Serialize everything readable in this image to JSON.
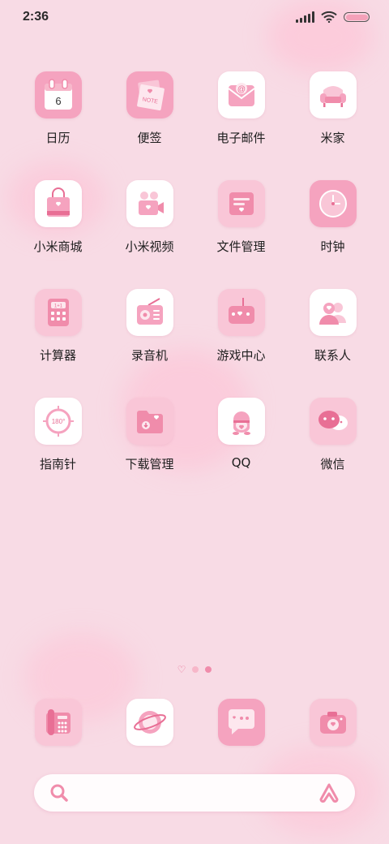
{
  "status_bar": {
    "time": "2:36"
  },
  "apps": [
    {
      "label": "日历",
      "calendar_day": "6"
    },
    {
      "label": "便签",
      "note_text": "NOTE"
    },
    {
      "label": "电子邮件"
    },
    {
      "label": "米家"
    },
    {
      "label": "小米商城"
    },
    {
      "label": "小米视频"
    },
    {
      "label": "文件管理"
    },
    {
      "label": "时钟"
    },
    {
      "label": "计算器",
      "calc_display": "1+1"
    },
    {
      "label": "录音机"
    },
    {
      "label": "游戏中心"
    },
    {
      "label": "联系人"
    },
    {
      "label": "指南针",
      "compass_reading": "180°"
    },
    {
      "label": "下载管理"
    },
    {
      "label": "QQ"
    },
    {
      "label": "微信"
    }
  ],
  "dock": [
    {
      "icon": "phone-icon"
    },
    {
      "icon": "browser-icon"
    },
    {
      "icon": "messages-icon"
    },
    {
      "icon": "camera-icon"
    }
  ],
  "page_indicator": {
    "total": 3,
    "active_index": 2
  },
  "colors": {
    "background": "#f8dbe5",
    "accent": "#f08cab",
    "icon_pink": "#f5a3bf"
  }
}
